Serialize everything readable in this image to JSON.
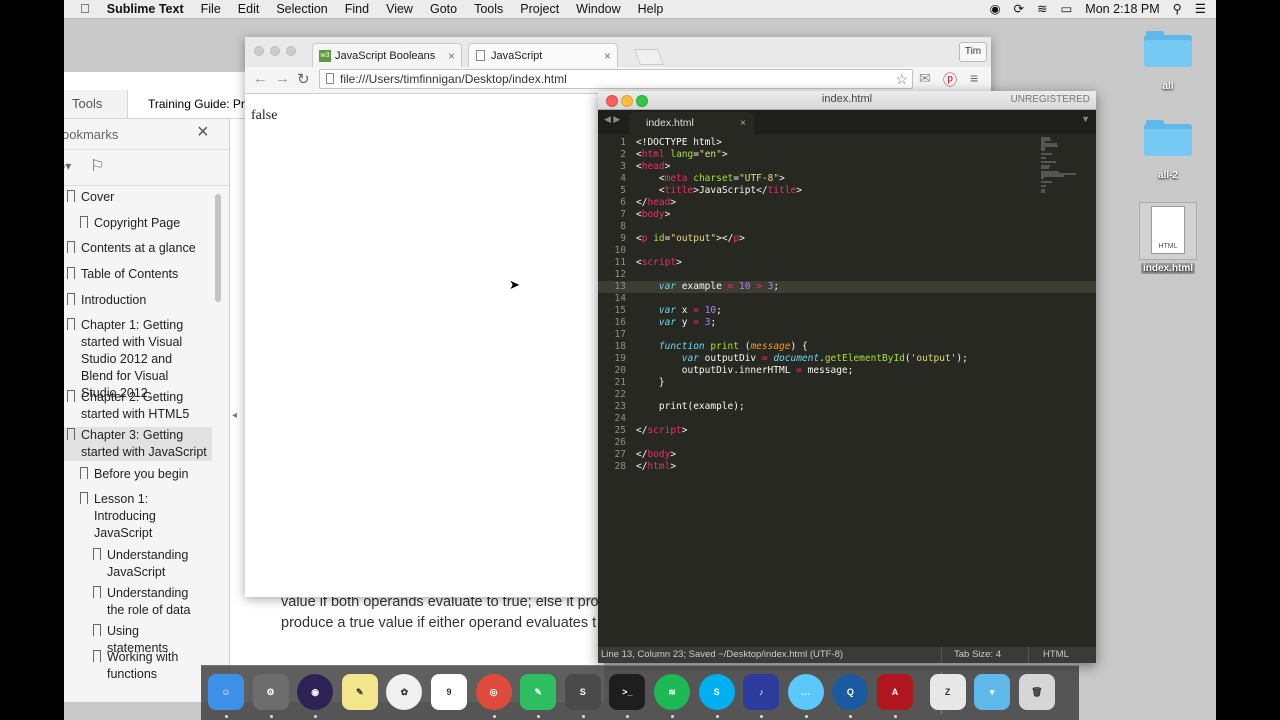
{
  "menubar": {
    "app_name": "Sublime Text",
    "items": [
      "File",
      "Edit",
      "Selection",
      "Find",
      "View",
      "Goto",
      "Tools",
      "Project",
      "Window",
      "Help"
    ],
    "clock": "Mon 2:18 PM"
  },
  "reader": {
    "tab_tools": "Tools",
    "tab_doc": "Training Guide: Pr...",
    "panel_title": "ookmarks",
    "bookmarks": [
      {
        "label": "Cover"
      },
      {
        "label": "Copyright Page"
      },
      {
        "label": "Contents at a glance"
      },
      {
        "label": "Table of Contents"
      },
      {
        "label": "Introduction"
      },
      {
        "label": "Chapter 1: Getting started with Visual Studio 2012 and Blend for Visual Studio 2012"
      },
      {
        "label": "Chapter 2: Getting started with HTML5"
      },
      {
        "label": "Chapter 3: Getting started with JavaScript"
      },
      {
        "label": "Before you begin"
      },
      {
        "label": "Lesson 1: Introducing JavaScript"
      },
      {
        "label": "Understanding JavaScript"
      },
      {
        "label": "Understanding the role of data"
      },
      {
        "label": "Using statements"
      },
      {
        "label": "Working with functions"
      }
    ],
    "body_line1": "value if both operands evaluate to true; else it pro",
    "body_line2": "produce a true value if either operand evaluates t"
  },
  "browser": {
    "tabs": [
      {
        "label": "JavaScript Booleans",
        "favicon": "w3"
      },
      {
        "label": "JavaScript"
      }
    ],
    "profile": "Tim",
    "url": "file:///Users/timfinnigan/Desktop/index.html",
    "page_output": "false"
  },
  "editor": {
    "window_title": "index.html",
    "license_status": "UNREGISTERED",
    "tab_label": "index.html",
    "status_left": "Line 13, Column 23; Saved ~/Desktop/index.html (UTF-8)",
    "tab_size": "Tab Size: 4",
    "syntax": "HTML",
    "current_line": 13,
    "line_numbers": [
      "1",
      "2",
      "3",
      "4",
      "5",
      "6",
      "7",
      "8",
      "9",
      "10",
      "11",
      "12",
      "13",
      "14",
      "15",
      "16",
      "17",
      "18",
      "19",
      "20",
      "21",
      "22",
      "23",
      "24",
      "25",
      "26",
      "27",
      "28"
    ],
    "code": [
      [
        {
          "t": "<!DOCTYPE html>",
          "c": ""
        }
      ],
      [
        {
          "t": "<",
          "c": ""
        },
        {
          "t": "html",
          "c": "tag"
        },
        {
          "t": " ",
          "c": ""
        },
        {
          "t": "lang",
          "c": "attr"
        },
        {
          "t": "=",
          "c": ""
        },
        {
          "t": "\"en\"",
          "c": "str"
        },
        {
          "t": ">",
          "c": ""
        }
      ],
      [
        {
          "t": "<",
          "c": ""
        },
        {
          "t": "head",
          "c": "tag"
        },
        {
          "t": ">",
          "c": ""
        }
      ],
      [
        {
          "t": "    <",
          "c": ""
        },
        {
          "t": "meta",
          "c": "tag"
        },
        {
          "t": " ",
          "c": ""
        },
        {
          "t": "charset",
          "c": "attr"
        },
        {
          "t": "=",
          "c": ""
        },
        {
          "t": "\"UTF-8\"",
          "c": "str"
        },
        {
          "t": ">",
          "c": ""
        }
      ],
      [
        {
          "t": "    <",
          "c": ""
        },
        {
          "t": "title",
          "c": "tag"
        },
        {
          "t": ">JavaScript</",
          "c": ""
        },
        {
          "t": "title",
          "c": "tag"
        },
        {
          "t": ">",
          "c": ""
        }
      ],
      [
        {
          "t": "</",
          "c": ""
        },
        {
          "t": "head",
          "c": "tag"
        },
        {
          "t": ">",
          "c": ""
        }
      ],
      [
        {
          "t": "<",
          "c": ""
        },
        {
          "t": "body",
          "c": "tag"
        },
        {
          "t": ">",
          "c": ""
        }
      ],
      [],
      [
        {
          "t": "<",
          "c": ""
        },
        {
          "t": "p",
          "c": "tag"
        },
        {
          "t": " ",
          "c": ""
        },
        {
          "t": "id",
          "c": "attr"
        },
        {
          "t": "=",
          "c": ""
        },
        {
          "t": "\"output\"",
          "c": "str"
        },
        {
          "t": "></",
          "c": ""
        },
        {
          "t": "p",
          "c": "tag"
        },
        {
          "t": ">",
          "c": ""
        }
      ],
      [],
      [
        {
          "t": "<",
          "c": ""
        },
        {
          "t": "script",
          "c": "tag"
        },
        {
          "t": ">",
          "c": ""
        }
      ],
      [],
      [
        {
          "t": "    ",
          "c": ""
        },
        {
          "t": "var",
          "c": "kw"
        },
        {
          "t": " example ",
          "c": ""
        },
        {
          "t": "=",
          "c": "op"
        },
        {
          "t": " ",
          "c": ""
        },
        {
          "t": "10",
          "c": "num"
        },
        {
          "t": " ",
          "c": ""
        },
        {
          "t": ">",
          "c": "op"
        },
        {
          "t": " ",
          "c": ""
        },
        {
          "t": "3",
          "c": "num"
        },
        {
          "t": ";",
          "c": ""
        }
      ],
      [],
      [
        {
          "t": "    ",
          "c": ""
        },
        {
          "t": "var",
          "c": "kw"
        },
        {
          "t": " x ",
          "c": ""
        },
        {
          "t": "=",
          "c": "op"
        },
        {
          "t": " ",
          "c": ""
        },
        {
          "t": "10",
          "c": "num"
        },
        {
          "t": ";",
          "c": ""
        }
      ],
      [
        {
          "t": "    ",
          "c": ""
        },
        {
          "t": "var",
          "c": "kw"
        },
        {
          "t": " y ",
          "c": ""
        },
        {
          "t": "=",
          "c": "op"
        },
        {
          "t": " ",
          "c": ""
        },
        {
          "t": "3",
          "c": "num"
        },
        {
          "t": ";",
          "c": ""
        }
      ],
      [],
      [
        {
          "t": "    ",
          "c": ""
        },
        {
          "t": "function",
          "c": "kw"
        },
        {
          "t": " ",
          "c": ""
        },
        {
          "t": "print",
          "c": "fn"
        },
        {
          "t": " (",
          "c": ""
        },
        {
          "t": "message",
          "c": "param"
        },
        {
          "t": ") {",
          "c": ""
        }
      ],
      [
        {
          "t": "        ",
          "c": ""
        },
        {
          "t": "var",
          "c": "kw"
        },
        {
          "t": " outputDiv ",
          "c": ""
        },
        {
          "t": "=",
          "c": "op"
        },
        {
          "t": " ",
          "c": ""
        },
        {
          "t": "document",
          "c": "kw"
        },
        {
          "t": ".",
          "c": ""
        },
        {
          "t": "getElementById",
          "c": "fn"
        },
        {
          "t": "(",
          "c": ""
        },
        {
          "t": "'output'",
          "c": "str"
        },
        {
          "t": ");",
          "c": ""
        }
      ],
      [
        {
          "t": "        outputDiv.innerHTML ",
          "c": ""
        },
        {
          "t": "=",
          "c": "op"
        },
        {
          "t": " message;",
          "c": ""
        }
      ],
      [
        {
          "t": "    }",
          "c": ""
        }
      ],
      [],
      [
        {
          "t": "    print(example);",
          "c": ""
        }
      ],
      [],
      [
        {
          "t": "</",
          "c": ""
        },
        {
          "t": "script",
          "c": "tag"
        },
        {
          "t": ">",
          "c": ""
        }
      ],
      [],
      [
        {
          "t": "</",
          "c": ""
        },
        {
          "t": "body",
          "c": "tag"
        },
        {
          "t": ">",
          "c": ""
        }
      ],
      [
        {
          "t": "</",
          "c": ""
        },
        {
          "t": "html",
          "c": "tag"
        },
        {
          "t": ">",
          "c": ""
        }
      ]
    ]
  },
  "desktop": {
    "icons": [
      {
        "label": "all",
        "icon": "folder-icon"
      },
      {
        "label": "all-2",
        "icon": "folder-icon"
      },
      {
        "label": "index.html",
        "icon": "html-file-icon",
        "badge": "HTML"
      }
    ]
  },
  "dock": {
    "apps": [
      {
        "name": "finder",
        "color": "#3d8fe8",
        "glyph": "☺"
      },
      {
        "name": "system-preferences",
        "color": "#6d6d6d",
        "glyph": "⚙"
      },
      {
        "name": "eclipse",
        "color": "#2c2255",
        "glyph": "◉"
      },
      {
        "name": "stickies",
        "color": "#f2e58b",
        "glyph": "✎"
      },
      {
        "name": "photos",
        "color": "#f0f0f0",
        "glyph": "✿"
      },
      {
        "name": "calendar",
        "color": "#ffffff",
        "glyph": "9",
        "sub": "NOV"
      },
      {
        "name": "chrome",
        "color": "#de4a3c",
        "glyph": "◎"
      },
      {
        "name": "evernote",
        "color": "#2dbe60",
        "glyph": "✎"
      },
      {
        "name": "sublime-text",
        "color": "#4a4a4a",
        "glyph": "S"
      },
      {
        "name": "terminal",
        "color": "#1e1e1e",
        "glyph": ">_"
      },
      {
        "name": "spotify",
        "color": "#1db954",
        "glyph": "≋"
      },
      {
        "name": "skype",
        "color": "#00aff0",
        "glyph": "S"
      },
      {
        "name": "audacity",
        "color": "#2d3c9c",
        "glyph": "♪"
      },
      {
        "name": "messages",
        "color": "#5ac8fa",
        "glyph": "…"
      },
      {
        "name": "quicktime",
        "color": "#1a5aa0",
        "glyph": "Q"
      },
      {
        "name": "acrobat",
        "color": "#b0161d",
        "glyph": "A"
      },
      {
        "name": "archive-utility",
        "color": "#e8e8e8",
        "glyph": "Z"
      },
      {
        "name": "downloads-folder",
        "color": "#5fb8ea",
        "glyph": "▾"
      },
      {
        "name": "trash",
        "color": "#d6d6d6",
        "glyph": "🗑"
      }
    ]
  }
}
